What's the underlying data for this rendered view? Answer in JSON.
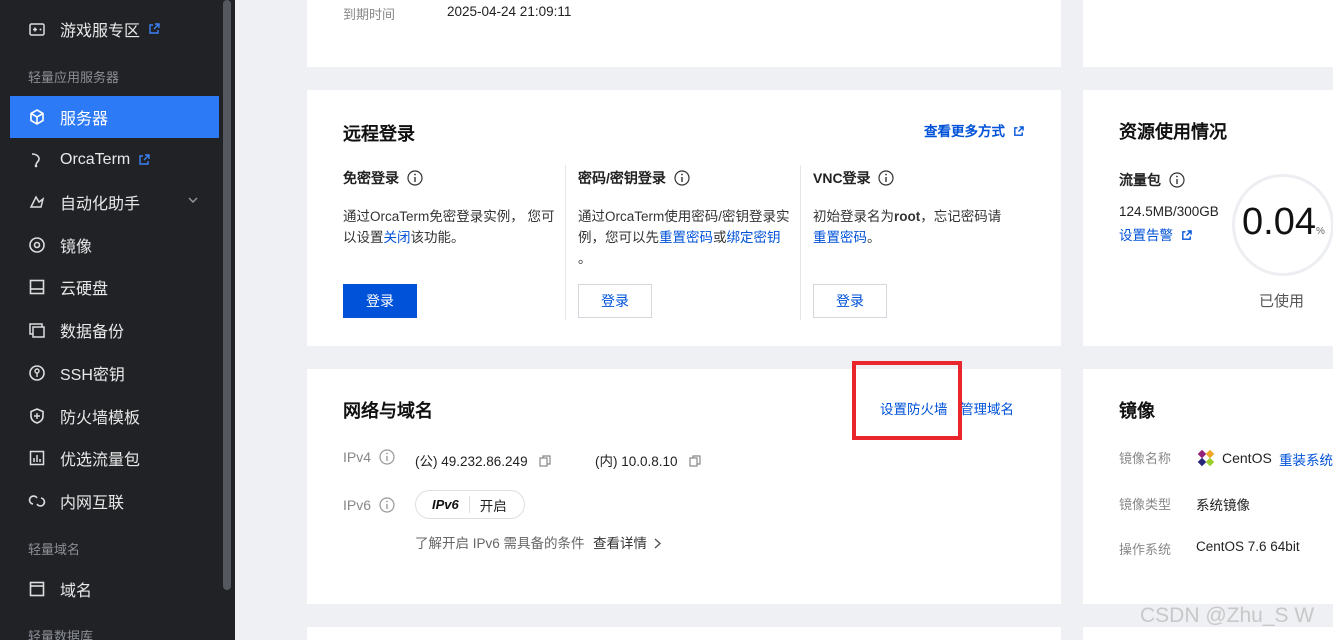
{
  "sidebar": {
    "items_top": [
      {
        "label": "游戏服专区",
        "icon": "gamepad-icon",
        "external": true
      }
    ],
    "group1": "轻量应用服务器",
    "items": [
      {
        "label": "服务器",
        "icon": "cube-icon",
        "active": true
      },
      {
        "label": "OrcaTerm",
        "icon": "terminal-icon",
        "external": true
      },
      {
        "label": "自动化助手",
        "icon": "automation-icon",
        "expand": true
      },
      {
        "label": "镜像",
        "icon": "image-disc-icon"
      },
      {
        "label": "云硬盘",
        "icon": "disk-icon"
      },
      {
        "label": "数据备份",
        "icon": "backup-icon"
      },
      {
        "label": "SSH密钥",
        "icon": "key-icon"
      },
      {
        "label": "防火墙模板",
        "icon": "shield-icon"
      },
      {
        "label": "优选流量包",
        "icon": "traffic-icon"
      },
      {
        "label": "内网互联",
        "icon": "network-icon"
      }
    ],
    "group2": "轻量域名",
    "items2": [
      {
        "label": "域名",
        "icon": "domain-icon"
      }
    ],
    "group3": "轻量数据库"
  },
  "top_card": {
    "expire_label": "到期时间",
    "expire_value": "2025-04-24 21:09:11"
  },
  "remote_login": {
    "title": "远程登录",
    "more_link": "查看更多方式",
    "col1": {
      "label": "免密登录",
      "desc_line1": "通过OrcaTerm免密登录实例， 您可",
      "desc_pre": "以设置",
      "desc_link": "关闭",
      "desc_post": "该功能。",
      "button": "登录"
    },
    "col2": {
      "label": "密码/密钥登录",
      "desc_line1": "通过OrcaTerm使用密码/密钥登录实",
      "desc_pre": "例，您可以先",
      "desc_link1": "重置密码",
      "desc_mid": "或",
      "desc_link2": "绑定密钥",
      "desc_line3": "。",
      "button": "登录"
    },
    "col3": {
      "label": "VNC登录",
      "desc_pre": "初始登录名为",
      "desc_bold": "root",
      "desc_post": "，忘记密码请",
      "desc_link": "重置密码",
      "desc_end": "。",
      "button": "登录"
    }
  },
  "resource": {
    "title": "资源使用情况",
    "traffic_label": "流量包",
    "traffic_value": "124.5MB/300GB",
    "alarm_link": "设置告警",
    "percent": "0.04",
    "percent_unit": "%",
    "used_label": "已使用",
    "used_fraction": 0.0004
  },
  "network": {
    "title": "网络与域名",
    "firewall_link": "设置防火墙",
    "domain_link": "管理域名",
    "ipv4_label": "IPv4",
    "ipv4_public": "(公) 49.232.86.249",
    "ipv4_private": "(内) 10.0.8.10",
    "ipv6_label": "IPv6",
    "ipv6_badge": "IPv6",
    "ipv6_status": "开启",
    "ipv6_hint": "了解开启 IPv6 需具备的条件",
    "ipv6_detail": "查看详情"
  },
  "image": {
    "title": "镜像",
    "name_label": "镜像名称",
    "name_value": "CentOS",
    "reinstall_link": "重装系统",
    "type_label": "镜像类型",
    "type_value": "系统镜像",
    "os_label": "操作系统",
    "os_value": "CentOS 7.6 64bit"
  },
  "watermark": "CSDN @Zhu_S W",
  "colors": {
    "sidebar_bg": "#202226",
    "active": "#2d7af7",
    "primary": "#0052d9",
    "highlight_box": "#e8262b"
  }
}
